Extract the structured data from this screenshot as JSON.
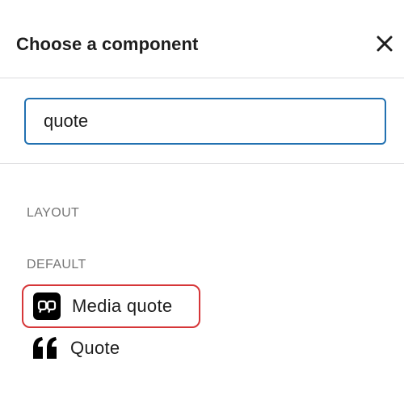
{
  "header": {
    "title": "Choose a component",
    "close_icon": "close-icon"
  },
  "search": {
    "value": "quote",
    "placeholder": ""
  },
  "sections": {
    "layout": {
      "heading": "LAYOUT"
    },
    "default": {
      "heading": "DEFAULT",
      "items": [
        {
          "label": "Media quote",
          "icon": "media-quote-icon",
          "highlighted": true
        },
        {
          "label": "Quote",
          "icon": "quote-icon",
          "highlighted": false
        }
      ]
    }
  },
  "colors": {
    "input_focus_border": "#2271b1",
    "highlight_border": "#d63638",
    "section_heading": "#757575",
    "divider": "#dcdcde",
    "text": "#1e1e1e"
  }
}
